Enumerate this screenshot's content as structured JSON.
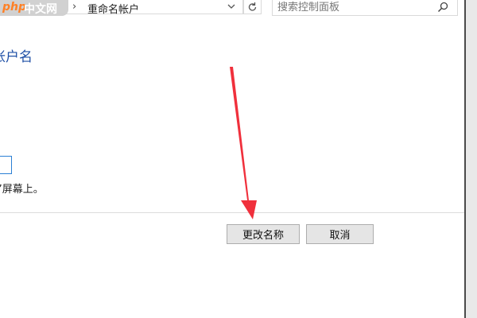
{
  "address_bar": {
    "breadcrumb_separator": "›",
    "current_location": "重命名帐户",
    "dropdown_icon": "chevron-down-icon",
    "refresh_icon": "refresh-icon"
  },
  "search": {
    "placeholder": "搜索控制面板",
    "icon": "search-icon"
  },
  "watermark": {
    "logo_text": "php中文网"
  },
  "page": {
    "title_partial": "帐户名",
    "hint_partial": "”屏幕上。"
  },
  "buttons": {
    "rename_label": "更改名称",
    "cancel_label": "取消"
  },
  "annotation": {
    "arrow_color": "#f0303c"
  }
}
